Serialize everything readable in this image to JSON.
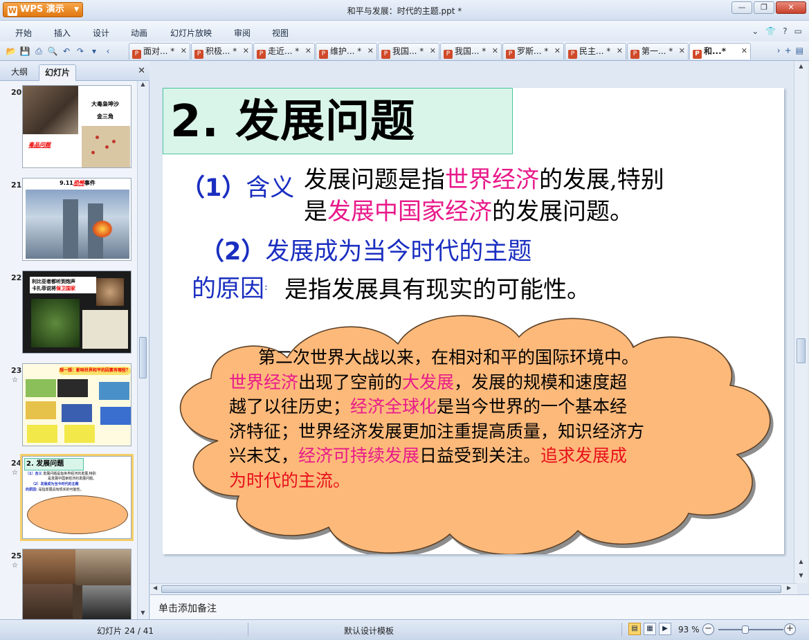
{
  "app": {
    "name": "WPS 演示",
    "window_title": "和平与发展：时代的主题.ppt *"
  },
  "menu": {
    "items": [
      "开始",
      "插入",
      "设计",
      "动画",
      "幻灯片放映",
      "审阅",
      "视图"
    ]
  },
  "doc_tabs": [
    {
      "label": "面对...",
      "modified": "*",
      "active": false
    },
    {
      "label": "积极...",
      "modified": "*",
      "active": false
    },
    {
      "label": "走近...",
      "modified": "*",
      "active": false
    },
    {
      "label": "维护...",
      "modified": "*",
      "active": false
    },
    {
      "label": "我国...",
      "modified": "*",
      "active": false
    },
    {
      "label": "我国...",
      "modified": "*",
      "active": false
    },
    {
      "label": "罗斯...",
      "modified": "*",
      "active": false
    },
    {
      "label": "民主...",
      "modified": "*",
      "active": false
    },
    {
      "label": "第一...",
      "modified": "*",
      "active": false
    },
    {
      "label": "和...",
      "modified": "*",
      "active": true
    }
  ],
  "left_panel": {
    "tab_outline": "大纲",
    "tab_slides": "幻灯片",
    "thumbnails": [
      {
        "number": "20",
        "texts": [
          "大毒枭坤沙",
          "金三角",
          "毒品问题"
        ],
        "starred": false,
        "selected": false
      },
      {
        "number": "21",
        "texts": [
          "9.11",
          "恐怖",
          "事件"
        ],
        "starred": false,
        "selected": false
      },
      {
        "number": "22",
        "texts": [
          "利比亚者都听到炮声",
          "卡扎菲说将",
          "保卫国家"
        ],
        "starred": false,
        "selected": false
      },
      {
        "number": "23",
        "texts": [
          "想一想：影响世界和平的因素有哪些？"
        ],
        "starred": true,
        "selected": false
      },
      {
        "number": "24",
        "texts": [
          "2. 发展问题"
        ],
        "starred": true,
        "selected": true
      },
      {
        "number": "25",
        "texts": [],
        "starred": true,
        "selected": false
      }
    ]
  },
  "slide": {
    "title": "2. 发展问题",
    "label1_num": "（1）",
    "label1_text": "含义",
    "def_line1_a": "发展问题是指",
    "def_line1_b": "世界经济",
    "def_line1_c": "的发展,特别",
    "def_line2_a": "是",
    "def_line2_b": "发展中国家经济",
    "def_line2_c": "的发展问题。",
    "label2_num": "（2）",
    "label2_text": "发展成为当今时代的主题",
    "label3_text": "的原因",
    "label3_colon": ":",
    "reason": "是指发展具有现实的可能性。",
    "cloud": [
      {
        "t": "第二次世界大战以来，在相对和平的国际环境中。",
        "c": ""
      },
      {
        "t": "世界经济",
        "c": "pk"
      },
      {
        "t": "出现了空前的",
        "c": ""
      },
      {
        "t": "大发展",
        "c": "pk"
      },
      {
        "t": "，发展的规模和速度超越了以往历史；",
        "c": ""
      },
      {
        "t": "经济全球化",
        "c": "pk"
      },
      {
        "t": "是当今世界的一个基本经济特征；世界经济发展更加注重提高质量，知识经济方兴未艾，",
        "c": ""
      },
      {
        "t": "经济可持续发展",
        "c": "pk"
      },
      {
        "t": "日益受到关注。",
        "c": ""
      },
      {
        "t": "追求发展成为时代的主流。",
        "c": "rd"
      }
    ]
  },
  "notes": {
    "placeholder": "单击添加备注"
  },
  "status": {
    "slide_counter": "幻灯片 24 / 41",
    "template": "默认设计模板",
    "zoom": "93 %",
    "zoom_fraction": 0.93
  },
  "colors": {
    "accent_orange": "#e07811",
    "slide_blue": "#1a2ec0",
    "slide_pink": "#e8198a",
    "slide_red": "#e8101c",
    "cloud_fill": "#fdb97a",
    "title_bg": "#d9f5ea"
  }
}
